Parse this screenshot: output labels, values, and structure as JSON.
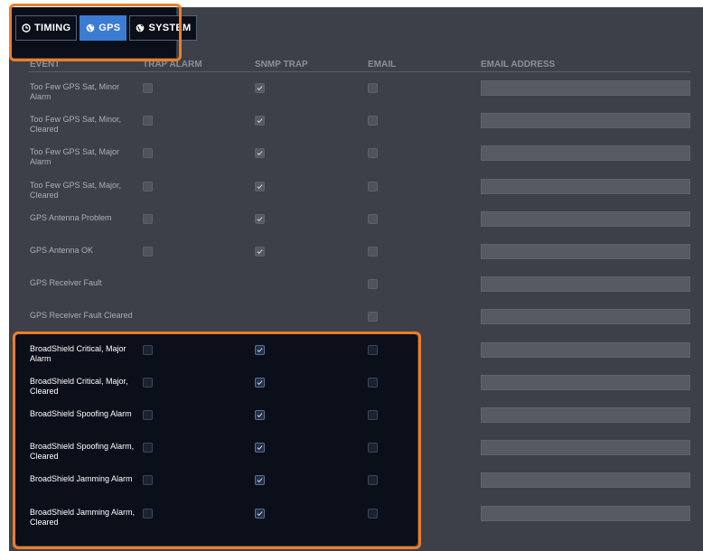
{
  "tabs": [
    {
      "label": "TIMING",
      "icon": "clock-icon",
      "active": false
    },
    {
      "label": "GPS",
      "icon": "globe-icon",
      "active": true
    },
    {
      "label": "SYSTEM",
      "icon": "globe-icon",
      "active": false
    }
  ],
  "columns": {
    "event": "EVENT",
    "trap_alarm": "TRAP ALARM",
    "snmp_trap": "SNMP TRAP",
    "email": "EMAIL",
    "email_address": "EMAIL ADDRESS"
  },
  "events": [
    {
      "label": "Too Few GPS Sat, Minor Alarm",
      "trap_alarm": false,
      "snmp_trap": true,
      "email": false,
      "email_address": ""
    },
    {
      "label": "Too Few GPS Sat, Minor, Cleared",
      "trap_alarm": false,
      "snmp_trap": true,
      "email": false,
      "email_address": ""
    },
    {
      "label": "Too Few GPS Sat, Major Alarm",
      "trap_alarm": false,
      "snmp_trap": true,
      "email": false,
      "email_address": ""
    },
    {
      "label": "Too Few GPS Sat, Major, Cleared",
      "trap_alarm": false,
      "snmp_trap": true,
      "email": false,
      "email_address": ""
    },
    {
      "label": "GPS Antenna Problem",
      "trap_alarm": false,
      "snmp_trap": true,
      "email": false,
      "email_address": ""
    },
    {
      "label": "GPS Antenna OK",
      "trap_alarm": false,
      "snmp_trap": true,
      "email": false,
      "email_address": ""
    },
    {
      "label": "GPS Receiver Fault",
      "trap_alarm": null,
      "snmp_trap": null,
      "email": false,
      "email_address": ""
    },
    {
      "label": "GPS Receiver Fault Cleared",
      "trap_alarm": null,
      "snmp_trap": null,
      "email": false,
      "email_address": ""
    },
    {
      "label": "BroadShield Critical, Major Alarm",
      "trap_alarm": false,
      "snmp_trap": true,
      "email": false,
      "email_address": "",
      "highlighted": true
    },
    {
      "label": "BroadShield Critical, Major, Cleared",
      "trap_alarm": false,
      "snmp_trap": true,
      "email": false,
      "email_address": "",
      "highlighted": true
    },
    {
      "label": "BroadShield Spoofing Alarm",
      "trap_alarm": false,
      "snmp_trap": true,
      "email": false,
      "email_address": "",
      "highlighted": true
    },
    {
      "label": "BroadShield Spoofing Alarm, Cleared",
      "trap_alarm": false,
      "snmp_trap": true,
      "email": false,
      "email_address": "",
      "highlighted": true
    },
    {
      "label": "BroadShield Jamming Alarm",
      "trap_alarm": false,
      "snmp_trap": true,
      "email": false,
      "email_address": "",
      "highlighted": true
    },
    {
      "label": "BroadShield Jamming Alarm, Cleared",
      "trap_alarm": false,
      "snmp_trap": true,
      "email": false,
      "email_address": "",
      "highlighted": true
    }
  ],
  "colors": {
    "panel": "#3d4049",
    "tab_bar": "#0b0f1a",
    "active_tab": "#3c7bd2",
    "highlight_border": "#f07d22",
    "highlight_bg": "#0b0f1a"
  }
}
